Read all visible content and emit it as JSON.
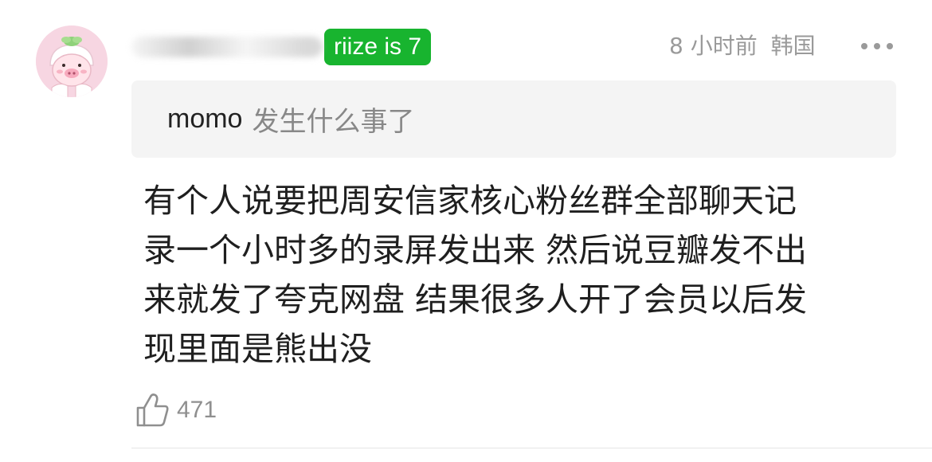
{
  "comment": {
    "avatar_icon": "pig-avatar-icon",
    "badge": "riize is 7",
    "badge_color": "#18b42f",
    "time": "8 小时前",
    "location": "韩国",
    "more_icon": "more-icon",
    "quote": {
      "name": "momo",
      "text": "发生什么事了"
    },
    "body_lines": [
      "有个人说要把周安信家核心粉丝群全部聊天记",
      "录一个小时多的录屏发出来 然后说豆瓣发不出",
      "来就发了夸克网盘 结果很多人开了会员以后发",
      "现里面是熊出没"
    ],
    "like_icon": "thumbs-up-icon",
    "like_count": "471"
  }
}
